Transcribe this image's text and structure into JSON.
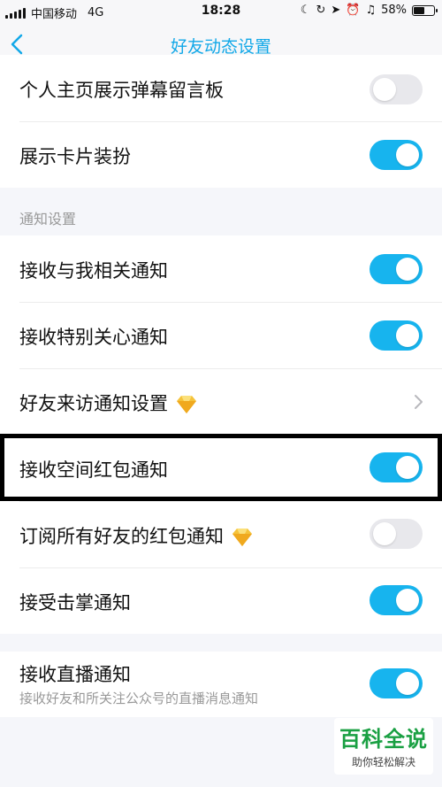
{
  "status_bar": {
    "carrier": "中国移动",
    "network": "4G",
    "time": "18:28",
    "battery_percent": "58%",
    "battery_level": 0.58
  },
  "nav": {
    "title": "好友动态设置",
    "back_icon": "chevron-left-icon"
  },
  "colors": {
    "accent": "#17b4ee",
    "toggle_off": "#e8e8ec",
    "title_blue": "#12a8e8",
    "background": "#f5f6fa"
  },
  "group1": {
    "items": [
      {
        "label": "个人主页展示弹幕留言板",
        "toggle": "off"
      },
      {
        "label": "展示卡片装扮",
        "toggle": "on"
      }
    ]
  },
  "section_notify": {
    "header": "通知设置",
    "items": [
      {
        "label": "接收与我相关通知",
        "toggle": "on"
      },
      {
        "label": "接收特别关心通知",
        "toggle": "on"
      },
      {
        "label": "好友来访通知设置",
        "badge_icon": "diamond-icon",
        "control": "chevron-right-icon"
      },
      {
        "label": "接收空间红包通知",
        "toggle": "on"
      },
      {
        "label": "订阅所有好友的红包通知",
        "badge_icon": "diamond-icon",
        "toggle": "off"
      },
      {
        "label": "接受击掌通知",
        "toggle": "on"
      }
    ]
  },
  "group3": {
    "items": [
      {
        "label": "接收直播通知",
        "subtitle": "接收好友和所关注公众号的直播消息通知",
        "toggle": "on"
      }
    ]
  },
  "watermark": {
    "title": "百科全说",
    "subtitle": "助你轻松解决"
  }
}
